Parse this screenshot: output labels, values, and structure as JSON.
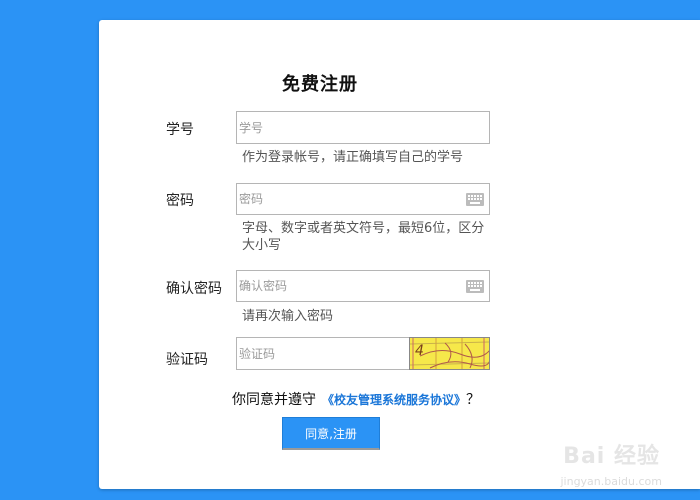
{
  "form": {
    "title": "免费注册",
    "student_id": {
      "label": "学号",
      "placeholder": "学号",
      "hint": "作为登录帐号，请正确填写自己的学号"
    },
    "password": {
      "label": "密码",
      "placeholder": "密码",
      "hint": "字母、数字或者英文符号，最短6位，区分大小写",
      "icon": "keyboard-icon"
    },
    "confirm_password": {
      "label": "确认密码",
      "placeholder": "确认密码",
      "hint": "请再次输入密码",
      "icon": "keyboard-icon"
    },
    "captcha": {
      "label": "验证码",
      "placeholder": "验证码",
      "image_text": "4"
    },
    "agreement": {
      "prefix": "你同意并遵守",
      "link": "《校友管理系统服务协议》",
      "suffix": "？"
    },
    "submit_label": "同意,注册"
  },
  "watermark": {
    "text": "Bai 经验",
    "url": "jingyan.baidu.com"
  },
  "colors": {
    "background": "#2b93f5",
    "panel": "#ffffff",
    "link": "#1a76d8",
    "button": "#2b93f5",
    "captcha_bg": "#f6e84a"
  }
}
